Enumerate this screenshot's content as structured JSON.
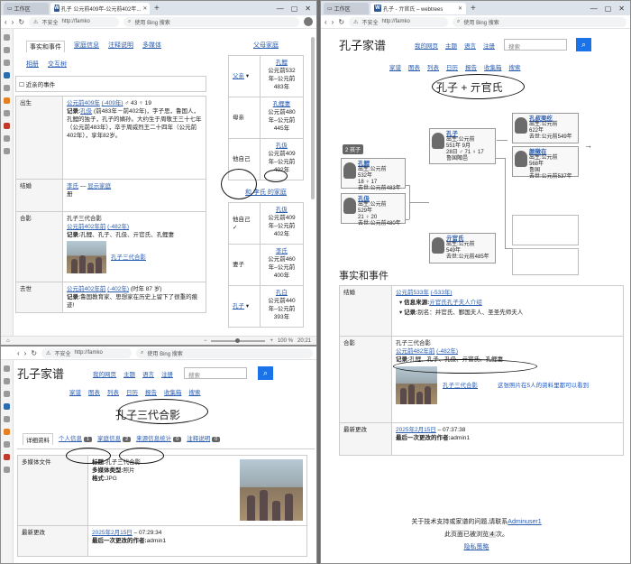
{
  "topleft": {
    "tabs": [
      {
        "label": "工作区"
      },
      {
        "label": "孔子 公元前409年-公元前402年..."
      }
    ],
    "url_warn": "不安全",
    "url_text": "http://famko",
    "search_ph": "使用 Bing 搜索",
    "tabs_row": [
      "事实和事件",
      "家庭信息",
      "注释说明",
      "多媒体"
    ],
    "tabs_row2": [
      "相册",
      "交互树"
    ],
    "recent": "近亲的事件",
    "events": [
      {
        "label": "出生",
        "l1a": "公元前409年",
        "l1b": "(-409年)",
        "l1c": "♂ 43 ♀ 19",
        "rec_label": "记录:",
        "rec_link": "孔伋",
        "rec_text": "(前483年－前402年)，字子思，鲁国人，孔鲤的独子，孔子的嫡孙。大约生于周敬王三十七年（公元前483年），卒于周威烈王二十四年（公元前402年），享年82岁。"
      },
      {
        "label": "结婚",
        "spouse": "李氏",
        "dash": "—",
        "show": "显示家庭",
        "extra": "册"
      },
      {
        "label": "合影",
        "title": "孔子三代合影",
        "date": "公元前402年前",
        "date2": "(-482年)",
        "rec_label": "记录:",
        "rec_text": "孔鲤、孔子、孔伋、亓官氏、孔鲤妻",
        "media": "孔子三代合影"
      },
      {
        "label": "去世",
        "date": "公元前402年前",
        "date2": "(-402年)",
        "age": "(时年 87 岁)",
        "rec_label": "记录:",
        "rec_text": "鲁国教育家、思想家在历史上留下了很重的痕迹!"
      }
    ],
    "family": {
      "title": "父母家庭",
      "father_label": "父亲",
      "father_name": "孔鲤",
      "father_d": [
        "公元前532",
        "年–公元前",
        "483年"
      ],
      "mother_label": "母亲",
      "mother_name": "孔鲤妻",
      "mother_d": [
        "公元前480",
        "年–公元前",
        "445年"
      ],
      "self_label": "他自己",
      "self_name": "孔伋",
      "self_d": [
        "公元前409",
        "年–公元前",
        "402年"
      ],
      "spouse_title": "和 李氏 的家庭",
      "self2_label": "他自己",
      "self2_name": "孔伋",
      "self2_d": [
        "公元前409",
        "年–公元前",
        "402年"
      ],
      "wife_label": "妻子",
      "wife_name": "李氏",
      "wife_d": [
        "公元前460",
        "年–公元前",
        "400年"
      ],
      "son_label": "孔子",
      "son_name": "孔白",
      "son_d": [
        "公元前440",
        "年–公元前",
        "393年"
      ]
    },
    "status": {
      "zoom": "100 %",
      "time": "20:21"
    }
  },
  "bottomleft": {
    "url_warn": "不安全",
    "url_text": "http://famko",
    "search_ph": "使用 Bing 搜索",
    "site_title": "孔子家谱",
    "menu1": [
      "我的网页",
      "主题",
      "语言",
      "注册"
    ],
    "menu2": [
      "家谱",
      "图表",
      "列表",
      "日历",
      "报告",
      "收集箱",
      "搜索"
    ],
    "search_ph2": "搜索",
    "heading": "孔子三代合影",
    "tabs": [
      {
        "label": "详细资料"
      },
      {
        "label": "个人信息",
        "badge": "1"
      },
      {
        "label": "家庭信息",
        "badge": "2"
      },
      {
        "label": "来源信息统计",
        "badge": "0"
      },
      {
        "label": "注释说明",
        "badge": "0"
      }
    ],
    "rows": [
      {
        "label": "多媒体文件",
        "l1k": "标题:",
        "l1v": "孔子三代合影",
        "l2k": "多媒体类型:",
        "l2v": "照片",
        "l3k": "格式:",
        "l3v": "JPG"
      },
      {
        "label": "最新更改",
        "date": "2025年2月15日",
        "time": "– 07:29:34",
        "byk": "最后一次更改的作者:",
        "byv": "admin1"
      }
    ]
  },
  "right": {
    "tabs": [
      {
        "label": "工作区"
      },
      {
        "label": "孔子 - 亓官氏 – webtrees"
      }
    ],
    "url_warn": "不安全",
    "url_text": "http://famko",
    "search_ph": "使用 Bing 搜索",
    "site_title": "孔子家谱",
    "menu1": [
      "我的网页",
      "主题",
      "语言",
      "注册"
    ],
    "menu2": [
      "家谱",
      "图表",
      "列表",
      "日历",
      "报告",
      "收集箱",
      "搜索"
    ],
    "search_ph2": "搜索",
    "heading": "孔子 + 亓官氏",
    "tree": {
      "count": "2 孩子",
      "persons": [
        {
          "key": "kongzhi",
          "name": "孔鲤",
          "l1": "出生:公元前",
          "l2": "532年",
          "l3": "18 ♀ 17",
          "l4": "去世:公元前483年"
        },
        {
          "key": "kongji",
          "name": "孔伋",
          "l1": "出生:公元前",
          "l2": "529年",
          "l3": "21 ♀ 20",
          "l4": "去世:公元前480年"
        },
        {
          "key": "kongzi",
          "name": "孔子",
          "l1": "出生:公元前",
          "l2": "551年 9月",
          "l3": "28日 ♂ 71 ♀ 17",
          "l4": "鲁国陬邑"
        },
        {
          "key": "qiguan",
          "name": "亓官氏",
          "l1": "出生:公元前",
          "l2": "549年",
          "l3": "",
          "l4": "去世:公元前485年"
        },
        {
          "key": "kongliang",
          "name": "孔叔梁纥",
          "l1": "出生:公元前",
          "l2": "622年",
          "l3": "",
          "l4": "去世:公元前549年"
        },
        {
          "key": "yanzhengzai",
          "name": "颜徵在",
          "l1": "出生:公元前",
          "l2": "568年",
          "l3": "鲁国",
          "l4": "去世:公元前537年"
        }
      ]
    },
    "facts_title": "事实和事件",
    "facts": [
      {
        "label": "结婚",
        "date": "公元前533年",
        "date2": "(-533年)",
        "src_k": "信息来源:",
        "src_v": "亓官氏孔子夫人介绍",
        "rec_k": "记录:",
        "rec_v": "别名：并官氏、鄞国夫人、圣圣先师夫人"
      },
      {
        "label": "合影",
        "title": "孔子三代合影",
        "date": "公元前482年前",
        "date2": "(-482年)",
        "rec_k": "记录:",
        "rec_v": "孔鲤、孔子、孔伋、亓官氏、孔鲤妻",
        "media": "孔子三代合影",
        "note": "这张照片在5人的资料里都可以看到"
      },
      {
        "label": "最新更改",
        "date": "2025年2月15日",
        "time": "– 07:37:38",
        "byk": "最后一次更改的作者:",
        "byv": "admin1"
      }
    ],
    "footer1a": "关于技术支持或家谱的问题,请联系",
    "footer1b": "Adminuser1",
    "footer2a": "此页面已被浏览",
    "footer2b": "4",
    "footer2c": "次。",
    "footer3": "隐私策略"
  }
}
